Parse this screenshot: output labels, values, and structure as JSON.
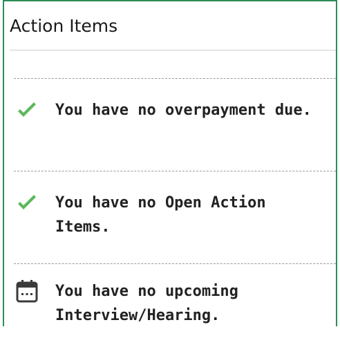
{
  "panel": {
    "title": "Action Items"
  },
  "items": [
    {
      "icon": "checkmark-icon",
      "text": "You have no overpayment due."
    },
    {
      "icon": "checkmark-icon",
      "text": "You have no Open Action Items."
    },
    {
      "icon": "calendar-icon",
      "text": "You have no upcoming Interview/Hearing."
    }
  ],
  "colors": {
    "panel_border": "#2e8b57",
    "check": "#5cb85c",
    "calendar": "#3a3a3a",
    "separator": "#9a9a9a"
  }
}
